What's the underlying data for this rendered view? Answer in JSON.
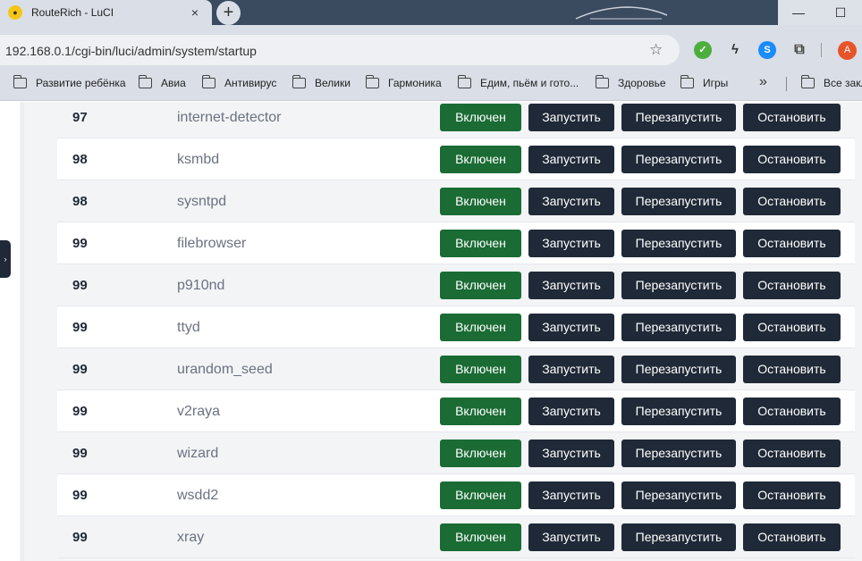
{
  "browser": {
    "tab_title": "RouteRich - LuCI",
    "tab_close": "×",
    "new_tab": "+",
    "url": "192.168.0.1/cgi-bin/luci/admin/system/startup",
    "avatar_letter": "A",
    "window_min": "—",
    "window_max": "☐"
  },
  "bookmarks": [
    {
      "label": "Развитие ребёнка"
    },
    {
      "label": "Авиа"
    },
    {
      "label": "Антивирус"
    },
    {
      "label": "Велики"
    },
    {
      "label": "Гармоника"
    },
    {
      "label": "Едим, пьём и гото..."
    },
    {
      "label": "Здоровье"
    },
    {
      "label": "Игры"
    },
    {
      "label": "Все закл"
    }
  ],
  "bookmarks_more": "»",
  "buttons": {
    "enabled": "Включен",
    "start": "Запустить",
    "restart": "Перезапустить",
    "stop": "Остановить"
  },
  "colors": {
    "enabled_green": "#1a6b34",
    "dark_button": "#1f2937",
    "row_odd": "#f3f4f6",
    "row_even": "#ffffff"
  },
  "services": [
    {
      "priority": "97",
      "name": "internet-detector"
    },
    {
      "priority": "98",
      "name": "ksmbd"
    },
    {
      "priority": "98",
      "name": "sysntpd"
    },
    {
      "priority": "99",
      "name": "filebrowser"
    },
    {
      "priority": "99",
      "name": "p910nd"
    },
    {
      "priority": "99",
      "name": "ttyd"
    },
    {
      "priority": "99",
      "name": "urandom_seed"
    },
    {
      "priority": "99",
      "name": "v2raya"
    },
    {
      "priority": "99",
      "name": "wizard"
    },
    {
      "priority": "99",
      "name": "wsdd2"
    },
    {
      "priority": "99",
      "name": "xray"
    }
  ]
}
